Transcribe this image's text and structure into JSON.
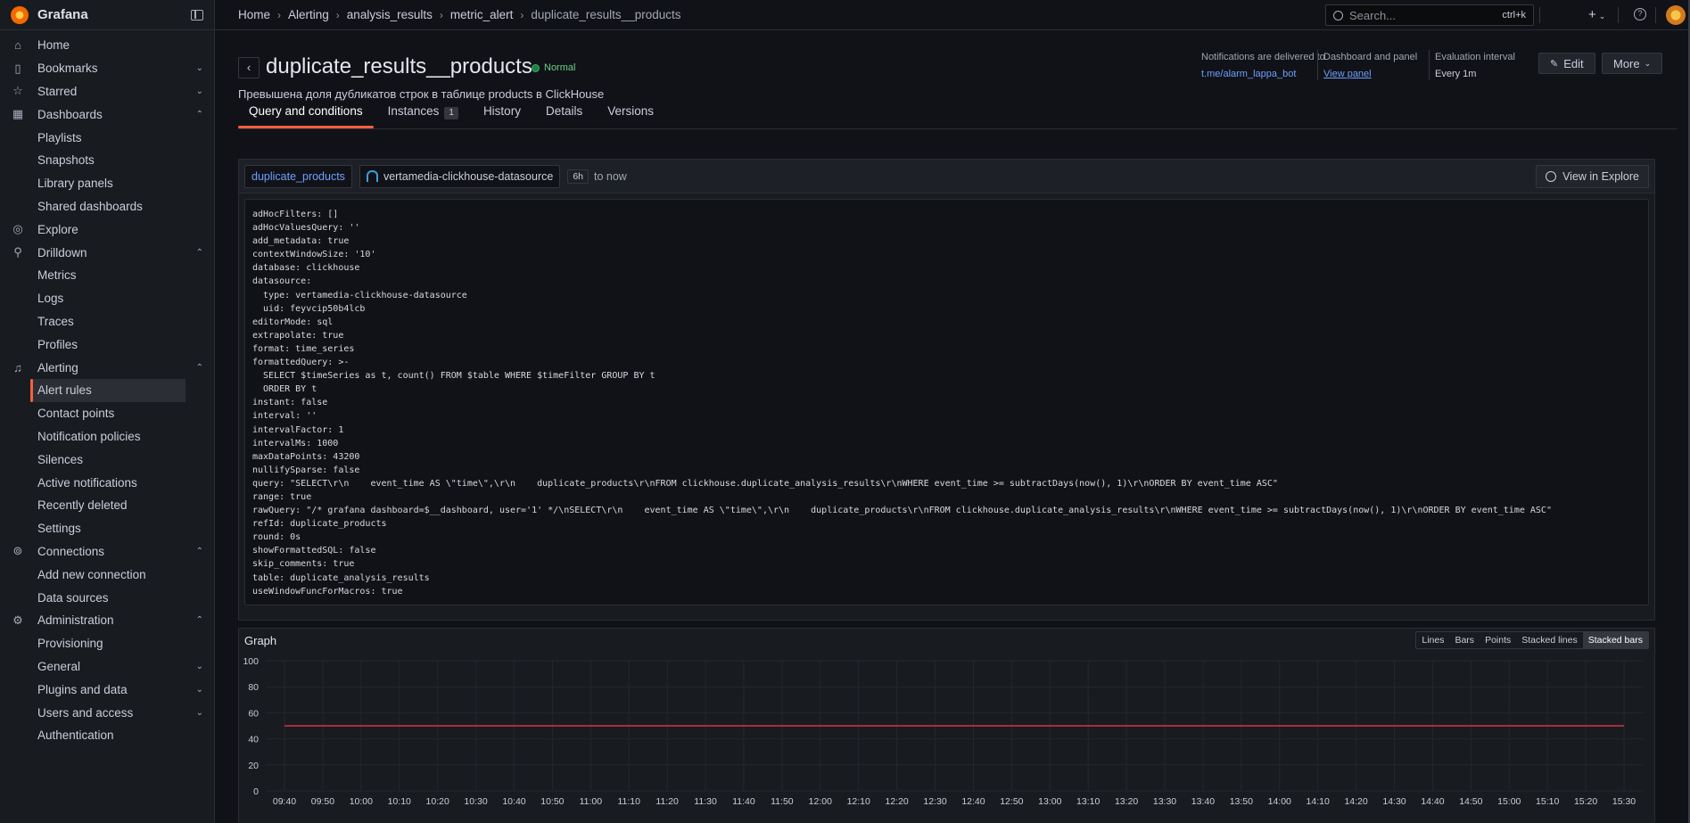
{
  "app": {
    "name": "Grafana"
  },
  "sidebar": {
    "items": [
      {
        "label": "Home",
        "icon": "home-icon",
        "level": "top",
        "chevron": ""
      },
      {
        "label": "Bookmarks",
        "icon": "bookmark-icon",
        "level": "top",
        "chevron": "⌄"
      },
      {
        "label": "Starred",
        "icon": "star-icon",
        "level": "top",
        "chevron": "⌄"
      },
      {
        "label": "Dashboards",
        "icon": "apps-icon",
        "level": "top",
        "chevron": "⌃"
      },
      {
        "label": "Playlists",
        "level": "sub"
      },
      {
        "label": "Snapshots",
        "level": "sub"
      },
      {
        "label": "Library panels",
        "level": "sub"
      },
      {
        "label": "Shared dashboards",
        "level": "sub"
      },
      {
        "label": "Explore",
        "icon": "compass-icon",
        "level": "top",
        "chevron": ""
      },
      {
        "label": "Drilldown",
        "icon": "microscope-icon",
        "level": "top",
        "chevron": "⌃"
      },
      {
        "label": "Metrics",
        "level": "sub"
      },
      {
        "label": "Logs",
        "level": "sub"
      },
      {
        "label": "Traces",
        "level": "sub"
      },
      {
        "label": "Profiles",
        "level": "sub"
      },
      {
        "label": "Alerting",
        "icon": "bell-icon",
        "level": "top",
        "chevron": "⌃"
      },
      {
        "label": "Alert rules",
        "level": "sub",
        "active": true
      },
      {
        "label": "Contact points",
        "level": "sub"
      },
      {
        "label": "Notification policies",
        "level": "sub"
      },
      {
        "label": "Silences",
        "level": "sub"
      },
      {
        "label": "Active notifications",
        "level": "sub"
      },
      {
        "label": "Recently deleted",
        "level": "sub"
      },
      {
        "label": "Settings",
        "level": "sub"
      },
      {
        "label": "Connections",
        "icon": "link-icon",
        "level": "top",
        "chevron": "⌃"
      },
      {
        "label": "Add new connection",
        "level": "sub"
      },
      {
        "label": "Data sources",
        "level": "sub"
      },
      {
        "label": "Administration",
        "icon": "cog-icon",
        "level": "top",
        "chevron": "⌃"
      },
      {
        "label": "Provisioning",
        "level": "sub"
      },
      {
        "label": "General",
        "level": "sub",
        "chevron": "⌄"
      },
      {
        "label": "Plugins and data",
        "level": "sub",
        "chevron": "⌄"
      },
      {
        "label": "Users and access",
        "level": "sub",
        "chevron": "⌄"
      },
      {
        "label": "Authentication",
        "level": "sub"
      }
    ]
  },
  "breadcrumbs": [
    "Home",
    "Alerting",
    "analysis_results",
    "metric_alert",
    "duplicate_results__products"
  ],
  "search": {
    "placeholder": "Search...",
    "shortcut": "ctrl+k"
  },
  "topbar": {
    "new_symbol": "+"
  },
  "rule": {
    "title": "duplicate_results__products",
    "state": "Normal",
    "description": "Превышена доля дубликатов строк в таблице products в ClickHouse"
  },
  "meta": {
    "notifications": {
      "label": "Notifications are delivered to",
      "value": "t.me/alarm_lappa_bot"
    },
    "dashboard": {
      "label": "Dashboard and panel",
      "value": "View panel"
    },
    "interval": {
      "label": "Evaluation interval",
      "value": "Every 1m"
    }
  },
  "actions": {
    "edit": "Edit",
    "more": "More"
  },
  "tabs": [
    {
      "label": "Query and conditions",
      "active": true
    },
    {
      "label": "Instances",
      "count": "1"
    },
    {
      "label": "History"
    },
    {
      "label": "Details"
    },
    {
      "label": "Versions"
    }
  ],
  "query": {
    "ref": "duplicate_products",
    "datasource": "vertamedia-clickhouse-datasource",
    "time_range": "6h",
    "time_to": "to now",
    "explore": "View in Explore",
    "lines": [
      "adHocFilters: []",
      "adHocValuesQuery: ''",
      "add_metadata: true",
      "contextWindowSize: '10'",
      "database: clickhouse",
      "datasource:",
      "  type: vertamedia-clickhouse-datasource",
      "  uid: feyvcip50b4lcb",
      "editorMode: sql",
      "extrapolate: true",
      "format: time_series",
      "formattedQuery: >-",
      "  SELECT $timeSeries as t, count() FROM $table WHERE $timeFilter GROUP BY t",
      "  ORDER BY t",
      "instant: false",
      "interval: ''",
      "intervalFactor: 1",
      "intervalMs: 1000",
      "maxDataPoints: 43200",
      "nullifySparse: false",
      "query: \"SELECT\\r\\n    event_time AS \\\"time\\\",\\r\\n    duplicate_products\\r\\nFROM clickhouse.duplicate_analysis_results\\r\\nWHERE event_time >= subtractDays(now(), 1)\\r\\nORDER BY event_time ASC\"",
      "range: true",
      "rawQuery: \"/* grafana dashboard=$__dashboard, user='1' */\\nSELECT\\r\\n    event_time AS \\\"time\\\",\\r\\n    duplicate_products\\r\\nFROM clickhouse.duplicate_analysis_results\\r\\nWHERE event_time >= subtractDays(now(), 1)\\r\\nORDER BY event_time ASC\"",
      "refId: duplicate_products",
      "round: 0s",
      "showFormattedSQL: false",
      "skip_comments: true",
      "table: duplicate_analysis_results",
      "useWindowFuncForMacros: true"
    ]
  },
  "graph": {
    "title": "Graph",
    "modes": [
      "Lines",
      "Bars",
      "Points",
      "Stacked lines",
      "Stacked bars"
    ],
    "active_mode": "Stacked bars"
  },
  "chart_data": {
    "type": "line",
    "x": [
      "09:40",
      "09:50",
      "10:00",
      "10:10",
      "10:20",
      "10:30",
      "10:40",
      "10:50",
      "11:00",
      "11:10",
      "11:20",
      "11:30",
      "11:40",
      "11:50",
      "12:00",
      "12:10",
      "12:20",
      "12:30",
      "12:40",
      "12:50",
      "13:00",
      "13:10",
      "13:20",
      "13:30",
      "13:40",
      "13:50",
      "14:00",
      "14:10",
      "14:20",
      "14:30",
      "14:40",
      "14:50",
      "15:00",
      "15:10",
      "15:20",
      "15:30"
    ],
    "yticks": [
      0,
      20,
      40,
      60,
      80,
      100
    ],
    "ylim": [
      0,
      100
    ],
    "series": [
      {
        "values": [
          50,
          50,
          50,
          50,
          50,
          50,
          50,
          50,
          50,
          50,
          50,
          50,
          50,
          50,
          50,
          50,
          50,
          50,
          50,
          50,
          50,
          50,
          50,
          50,
          50,
          50,
          50,
          50,
          50,
          50,
          50,
          50,
          50,
          50,
          50,
          50
        ],
        "color": "#e02f44"
      }
    ],
    "grid": true
  },
  "colors": {
    "accent": "#f55f3e",
    "link": "#6e9fff",
    "ok": "#3eb15b",
    "threshold": "#e02f44"
  }
}
